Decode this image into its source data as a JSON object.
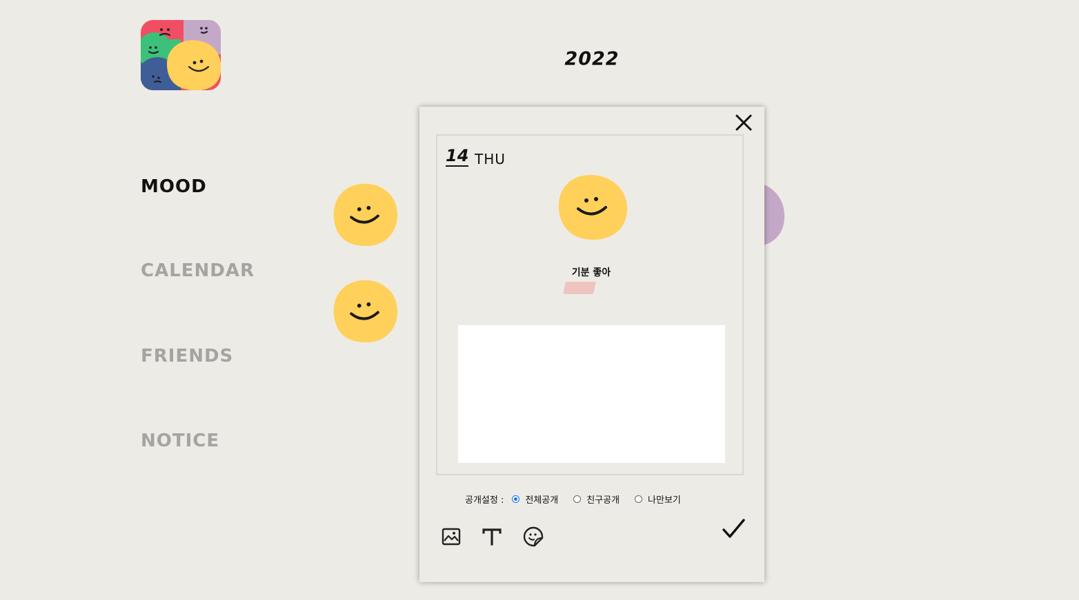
{
  "year": "2022",
  "nav": {
    "items": [
      {
        "label": "MOOD",
        "active": true
      },
      {
        "label": "CALENDAR",
        "active": false
      },
      {
        "label": "FRIENDS",
        "active": false
      },
      {
        "label": "NOTICE",
        "active": false
      }
    ]
  },
  "modal": {
    "date_num": "14",
    "date_day": "THU",
    "mood_label": "기분 좋아",
    "textbox_value": "",
    "privacy": {
      "label": "공개설정 :",
      "options": [
        "전체공개",
        "친구공개",
        "나만보기"
      ],
      "selected": "전체공개"
    },
    "tools": [
      "image-icon",
      "text-icon",
      "sticker-icon"
    ],
    "confirm_icon": "check-icon",
    "close_icon": "close-icon"
  },
  "colors": {
    "background": "#edebe5",
    "mood_yellow": "#ffd05a",
    "mood_purple": "#c4a8c8",
    "mood_red": "#f24e63",
    "mood_green": "#3cc07a",
    "mood_blue": "#3f5e98",
    "nav_inactive": "#a6a4a0",
    "radio_selected": "#1a73e8"
  }
}
